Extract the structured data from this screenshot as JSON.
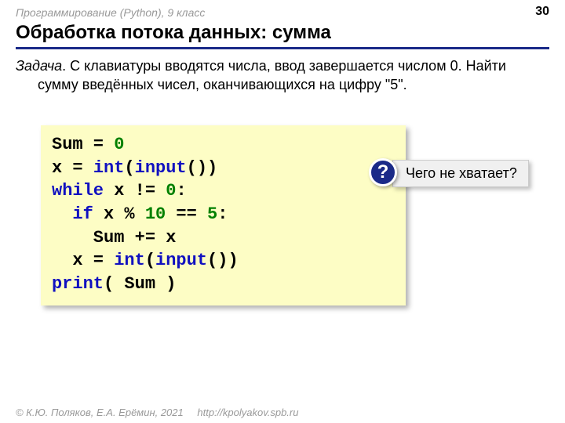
{
  "header": {
    "subtitle": "Программирование (Python), 9 класс",
    "page": "30"
  },
  "title": "Обработка потока данных: сумма",
  "task": {
    "label": "Задача",
    "text": ". С клавиатуры вводятся числа, ввод завершается числом 0. Найти сумму введённых чисел, оканчивающихся на цифру \"5\"."
  },
  "code": {
    "l1a": "Sum = ",
    "l1b": "0",
    "l2a": "x = ",
    "l2b": "int",
    "l2c": "(",
    "l2d": "input",
    "l2e": "())",
    "l3a": "while",
    "l3b": " x != ",
    "l3c": "0",
    "l3d": ":",
    "l4a": "  ",
    "l4b": "if",
    "l4c": " x % ",
    "l4d": "10",
    "l4e": " == ",
    "l4f": "5",
    "l4g": ":",
    "l5a": "    Sum += x",
    "l6a": "  x = ",
    "l6b": "int",
    "l6c": "(",
    "l6d": "input",
    "l6e": "())",
    "l7a": "print",
    "l7b": "( Sum )"
  },
  "question": {
    "mark": "?",
    "text": "Чего не хватает?"
  },
  "footer": {
    "copyright": "© К.Ю. Поляков, Е.А. Ерёмин, 2021",
    "link": "http://kpolyakov.spb.ru"
  }
}
